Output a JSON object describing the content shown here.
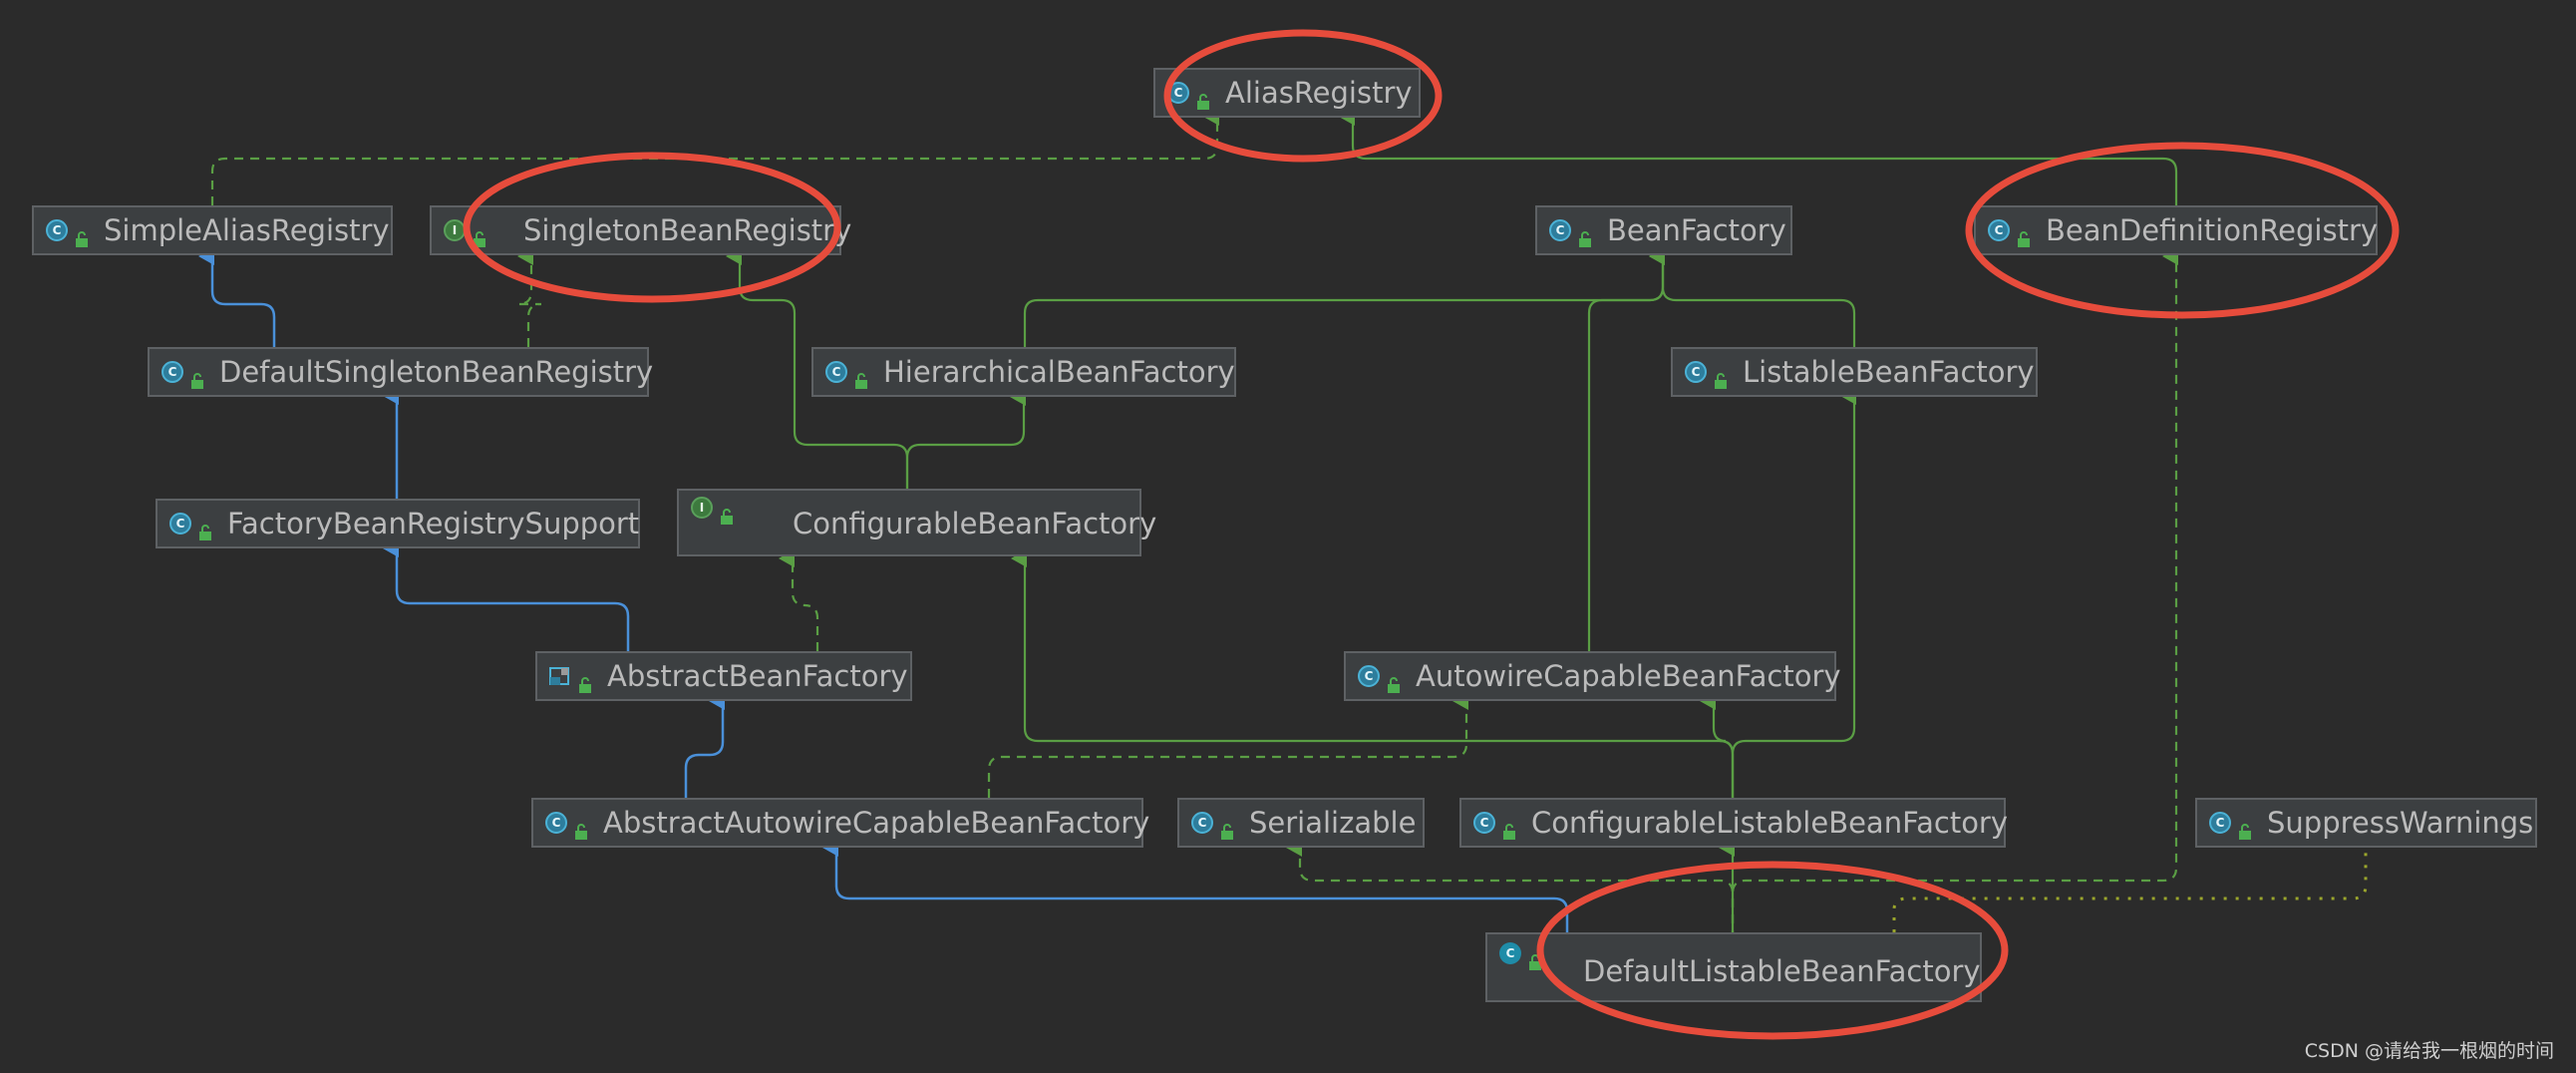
{
  "diagram": {
    "nodes": {
      "aliasRegistry": {
        "label": "AliasRegistry",
        "kind": "class-icon"
      },
      "simpleAliasRegistry": {
        "label": "SimpleAliasRegistry",
        "kind": "class-icon"
      },
      "singletonBeanRegistry": {
        "label": "SingletonBeanRegistry",
        "kind": "interface-icon"
      },
      "beanFactory": {
        "label": "BeanFactory",
        "kind": "class-icon"
      },
      "beanDefinitionRegistry": {
        "label": "BeanDefinitionRegistry",
        "kind": "class-icon"
      },
      "defaultSingletonBeanRegistry": {
        "label": "DefaultSingletonBeanRegistry",
        "kind": "class-icon"
      },
      "hierarchicalBeanFactory": {
        "label": "HierarchicalBeanFactory",
        "kind": "class-icon"
      },
      "listableBeanFactory": {
        "label": "ListableBeanFactory",
        "kind": "class-icon"
      },
      "factoryBeanRegistrySupport": {
        "label": "FactoryBeanRegistrySupport",
        "kind": "class-icon"
      },
      "configurableBeanFactory": {
        "label": "ConfigurableBeanFactory",
        "kind": "interface-icon"
      },
      "abstractBeanFactory": {
        "label": "AbstractBeanFactory",
        "kind": "abstract-class-icon"
      },
      "autowireCapableBeanFactory": {
        "label": "AutowireCapableBeanFactory",
        "kind": "class-icon"
      },
      "abstractAutowireCapableBeanFactory": {
        "label": "AbstractAutowireCapableBeanFactory",
        "kind": "class-icon"
      },
      "serializable": {
        "label": "Serializable",
        "kind": "class-icon"
      },
      "configurableListableBeanFactory": {
        "label": "ConfigurableListableBeanFactory",
        "kind": "class-icon"
      },
      "suppressWarnings": {
        "label": "SuppressWarnings",
        "kind": "class-icon"
      },
      "defaultListableBeanFactory": {
        "label": "DefaultListableBeanFactory",
        "kind": "class-icon"
      }
    },
    "icon_letters": {
      "interface": "I",
      "class": "C"
    },
    "colors": {
      "background": "#2b2b2b",
      "node_fill": "#3c3f41",
      "node_border": "#5e6164",
      "text": "#bbbbbb",
      "implements_edge": "#5a9e44",
      "extends_edge": "#4a90d9",
      "dependency_edge": "#9aa52c",
      "highlight_circle": "#e74c3c"
    }
  },
  "watermark": "CSDN @请给我一根烟的时间"
}
